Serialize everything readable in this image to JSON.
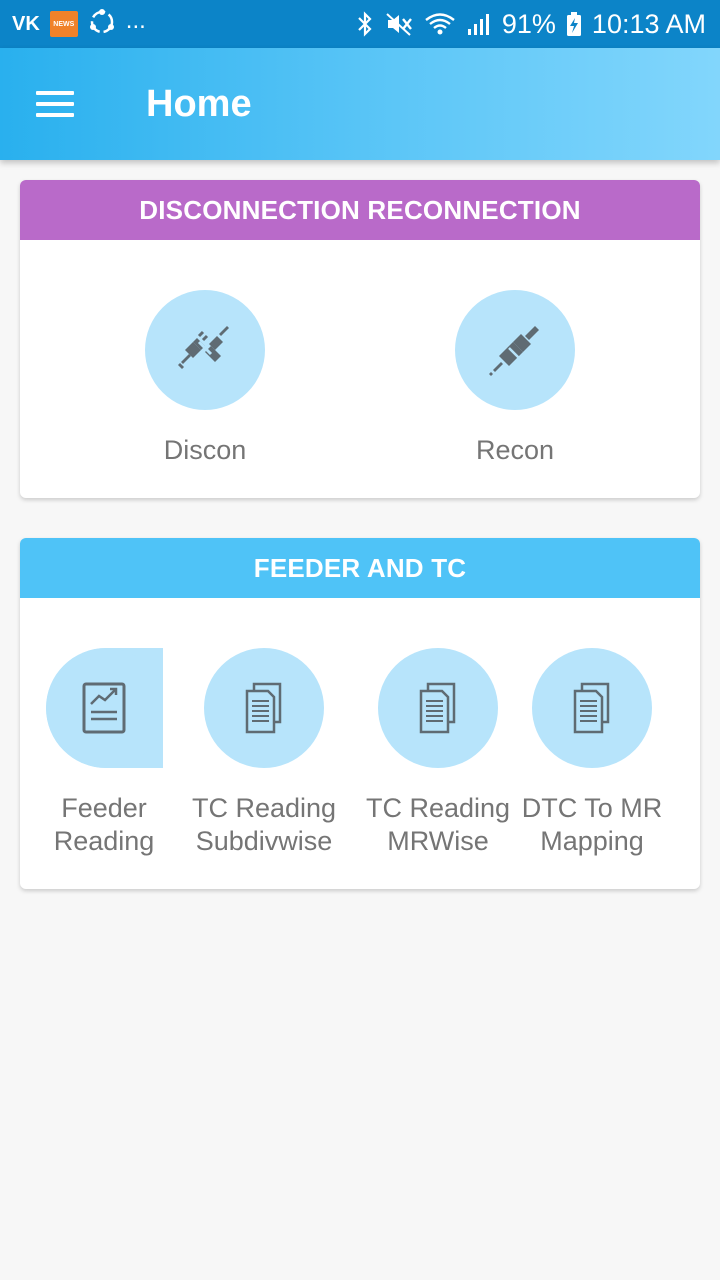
{
  "status_bar": {
    "left_label": "VK",
    "news_label": "NEWS",
    "dots": "...",
    "battery": "91%",
    "time": "10:13 AM"
  },
  "app_bar": {
    "title": "Home"
  },
  "sections": [
    {
      "title": "DISCONNECTION RECONNECTION",
      "color": "#b96ac9",
      "items": [
        {
          "label": "Discon",
          "icon": "plug-disconnect-icon"
        },
        {
          "label": "Recon",
          "icon": "plug-connect-icon"
        }
      ]
    },
    {
      "title": "FEEDER AND TC",
      "color": "#4fc3f7",
      "items": [
        {
          "label1": "Feeder",
          "label2": "Reading",
          "icon": "chart-report-icon"
        },
        {
          "label1": "TC Reading",
          "label2": "Subdivwise",
          "icon": "documents-icon"
        },
        {
          "label1": "TC Reading",
          "label2": "MRWise",
          "icon": "documents-icon"
        },
        {
          "label1": "DTC To MR",
          "label2": "Mapping",
          "icon": "documents-icon"
        }
      ]
    }
  ],
  "colors": {
    "status_bar": "#0c84c8",
    "app_bar_start": "#29b0ee",
    "app_bar_end": "#82d6fc",
    "icon_circle": "#b7e4fb",
    "icon": "#5f6b73",
    "label": "#757575"
  }
}
